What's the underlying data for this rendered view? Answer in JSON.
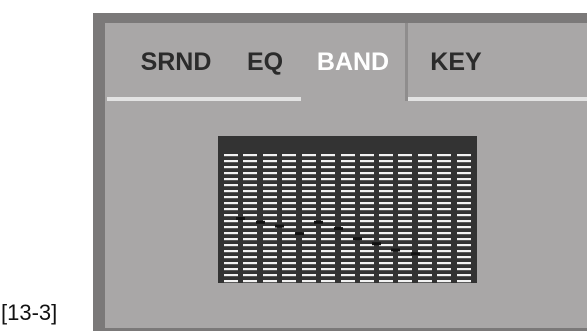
{
  "caption": "[13-3]",
  "tabs": [
    {
      "label": "SRND",
      "active": false
    },
    {
      "label": "EQ",
      "active": false
    },
    {
      "label": "BAND",
      "active": true
    },
    {
      "label": "KEY",
      "active": false
    }
  ],
  "eq_display": {
    "band_levels": [
      0.5,
      0.47,
      0.44,
      0.38,
      0.47,
      0.42,
      0.34,
      0.3,
      0.25,
      0.22
    ],
    "colors": {
      "background": "#333333",
      "segment": "#f2f2f2",
      "marker": "#111111"
    }
  }
}
